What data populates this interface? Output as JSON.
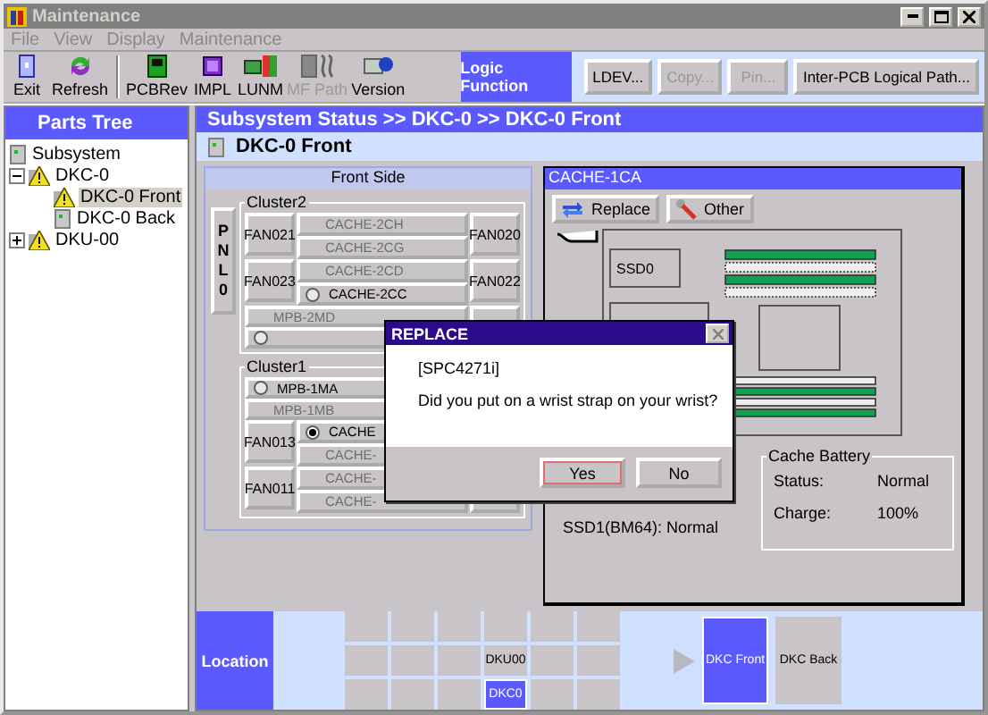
{
  "window": {
    "title": "Maintenance"
  },
  "menu": [
    {
      "label": "File",
      "disabled": true
    },
    {
      "label": "View",
      "disabled": true
    },
    {
      "label": "Display",
      "disabled": true
    },
    {
      "label": "Maintenance",
      "disabled": true
    }
  ],
  "toolbar": [
    {
      "label": "Exit",
      "disabled": false
    },
    {
      "label": "Refresh",
      "disabled": false
    },
    {
      "label": "PCBRev",
      "disabled": false
    },
    {
      "label": "IMPL",
      "disabled": false
    },
    {
      "label": "LUNM",
      "disabled": false
    },
    {
      "label": "MF Path",
      "disabled": true
    },
    {
      "label": "Version",
      "disabled": false
    }
  ],
  "logic_function": {
    "label": "Logic Function",
    "buttons": [
      {
        "label": "LDEV...",
        "disabled": false
      },
      {
        "label": "Copy...",
        "disabled": true
      },
      {
        "label": "Pin...",
        "disabled": true
      },
      {
        "label": "Inter-PCB Logical Path...",
        "disabled": false
      }
    ]
  },
  "parts_tree": {
    "title": "Parts Tree",
    "items": [
      {
        "label": "Subsystem",
        "warning": false,
        "selected": false
      },
      {
        "label": "DKC-0",
        "warning": true,
        "selected": false,
        "expanded": true,
        "children": [
          {
            "label": "DKC-0 Front",
            "warning": true,
            "selected": true
          },
          {
            "label": "DKC-0 Back",
            "warning": false,
            "selected": false
          }
        ]
      },
      {
        "label": "DKU-00",
        "warning": true,
        "selected": false,
        "expanded": false
      }
    ]
  },
  "breadcrumb": "Subsystem Status >> DKC-0 >> DKC-0 Front",
  "view_title": "DKC-0 Front",
  "front_side": {
    "title": "Front Side",
    "panel_label": "PNL0",
    "clusters": [
      {
        "title": "Cluster2",
        "blocks": [
          {
            "kind": "pair",
            "left": "FAN021",
            "right": "FAN020",
            "slots": [
              {
                "label": "CACHE-2CH",
                "disabled": true,
                "kind": "plain"
              },
              {
                "label": "CACHE-2CG",
                "disabled": true,
                "kind": "plain"
              }
            ]
          },
          {
            "kind": "pair",
            "left": "FAN023",
            "right": "FAN022",
            "slots": [
              {
                "label": "CACHE-2CD",
                "disabled": true,
                "kind": "plain"
              },
              {
                "label": "CACHE-2CC",
                "disabled": false,
                "kind": "radio",
                "selected": false
              }
            ]
          },
          {
            "kind": "wide",
            "slot": {
              "label": "MPB-2MD",
              "disabled": true,
              "kind": "plain"
            }
          },
          {
            "kind": "wide",
            "slot": {
              "kind": "radio",
              "selected": false
            }
          }
        ]
      },
      {
        "title": "Cluster1",
        "blocks": [
          {
            "kind": "wide",
            "slot": {
              "label": "MPB-1MA",
              "disabled": false,
              "kind": "radio",
              "selected": false
            }
          },
          {
            "kind": "wide",
            "slot": {
              "label": "MPB-1MB",
              "disabled": true,
              "kind": "plain"
            }
          },
          {
            "kind": "pair",
            "left": "FAN013",
            "slots": [
              {
                "label": "CACHE",
                "disabled": false,
                "kind": "radio",
                "selected": true
              },
              {
                "label": "CACHE-",
                "disabled": true,
                "kind": "plain"
              }
            ]
          },
          {
            "kind": "pair",
            "left": "FAN011",
            "slots": [
              {
                "label": "CACHE-",
                "disabled": true,
                "kind": "plain"
              },
              {
                "label": "CACHE-",
                "disabled": true,
                "kind": "plain"
              }
            ]
          }
        ]
      }
    ]
  },
  "cache_panel": {
    "title": "CACHE-1CA",
    "buttons": [
      "Replace",
      "Other"
    ],
    "ssd0": "SSD0",
    "ssd1": {
      "label": "SSD1(BM64):",
      "value": "Normal"
    },
    "battery": {
      "title": "Cache Battery",
      "rows": [
        {
          "label": "Status:",
          "value": "Normal"
        },
        {
          "label": "Charge:",
          "value": "100%"
        }
      ]
    }
  },
  "location": {
    "label": "Location",
    "cells": [
      {
        "selected": false
      },
      {
        "selected": false
      },
      {
        "selected": false
      },
      {
        "selected": false
      },
      {
        "selected": false
      },
      {
        "selected": false
      },
      {
        "selected": false
      },
      {
        "selected": false
      },
      {
        "selected": false
      },
      {
        "label": "DKU00",
        "selected": false
      },
      {
        "selected": false
      },
      {
        "selected": false
      },
      {
        "selected": false
      },
      {
        "selected": false
      },
      {
        "selected": false
      },
      {
        "label": "DKC0",
        "selected": true
      },
      {
        "selected": false
      },
      {
        "selected": false
      }
    ],
    "views": [
      {
        "label": "DKC Front",
        "selected": true
      },
      {
        "label": "DKC Back",
        "selected": false
      }
    ]
  },
  "dialog": {
    "title": "REPLACE",
    "code": "[SPC4271i]",
    "message": "Did you put on a wrist strap on your wrist?",
    "buttons": [
      {
        "label": "Yes",
        "focused": true
      },
      {
        "label": "No",
        "focused": false
      }
    ]
  }
}
